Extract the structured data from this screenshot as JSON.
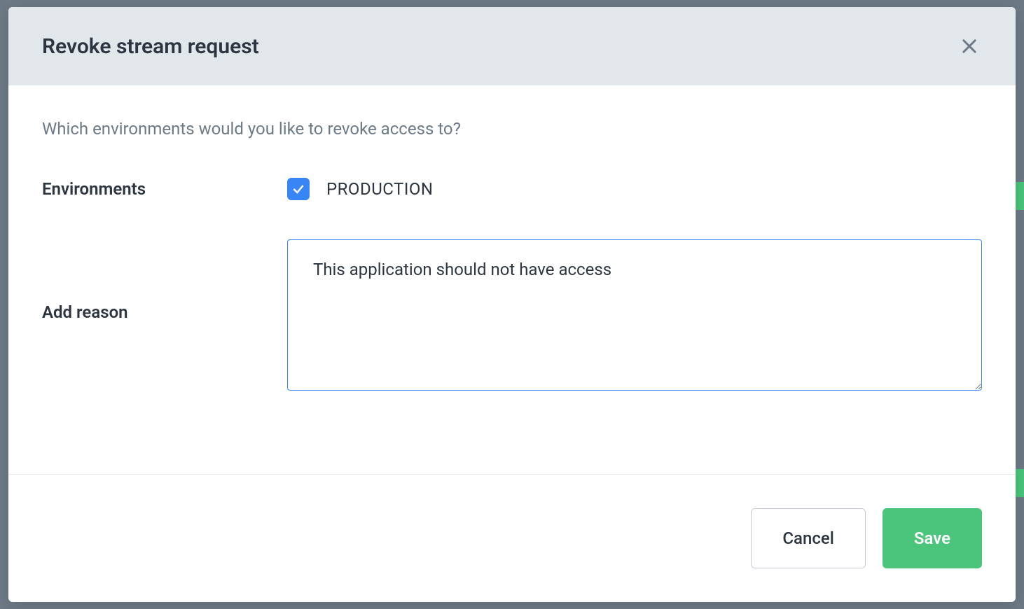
{
  "modal": {
    "title": "Revoke stream request",
    "prompt": "Which environments would you like to revoke access to?",
    "fields": {
      "environments": {
        "label": "Environments",
        "option_label": "PRODUCTION",
        "checked": true
      },
      "reason": {
        "label": "Add reason",
        "value": "This application should not have access"
      }
    },
    "buttons": {
      "cancel": "Cancel",
      "save": "Save"
    }
  },
  "colors": {
    "primary_blue": "#3885f5",
    "success_green": "#4bc47c",
    "header_bg": "#e2e7ec",
    "muted_text": "#6d7a86",
    "body_text": "#2c3540"
  }
}
